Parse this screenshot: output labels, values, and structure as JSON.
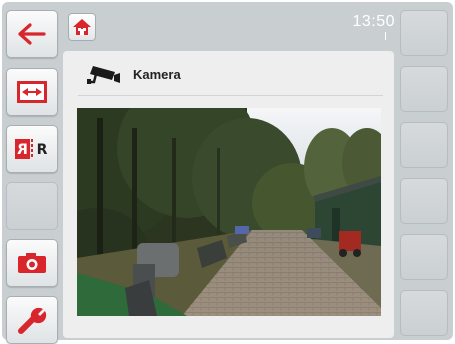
{
  "header": {
    "clock": "13:50"
  },
  "sidebar_left": {
    "buttons": [
      {
        "name": "back-button",
        "icon": "arrow-left-icon"
      },
      {
        "name": "fit-screen-button",
        "icon": "fit-screen-icon"
      },
      {
        "name": "mirror-button",
        "icon": "mirror-r-icon",
        "label": "R"
      },
      {
        "name": "empty-slot",
        "icon": ""
      },
      {
        "name": "snapshot-button",
        "icon": "camera-icon"
      },
      {
        "name": "settings-button",
        "icon": "wrench-icon"
      }
    ]
  },
  "panel": {
    "title": "Kamera",
    "icon": "surveillance-camera-icon"
  },
  "colors": {
    "accent": "#d9262c",
    "background": "#c9ced1",
    "panel": "#eeeeee"
  }
}
